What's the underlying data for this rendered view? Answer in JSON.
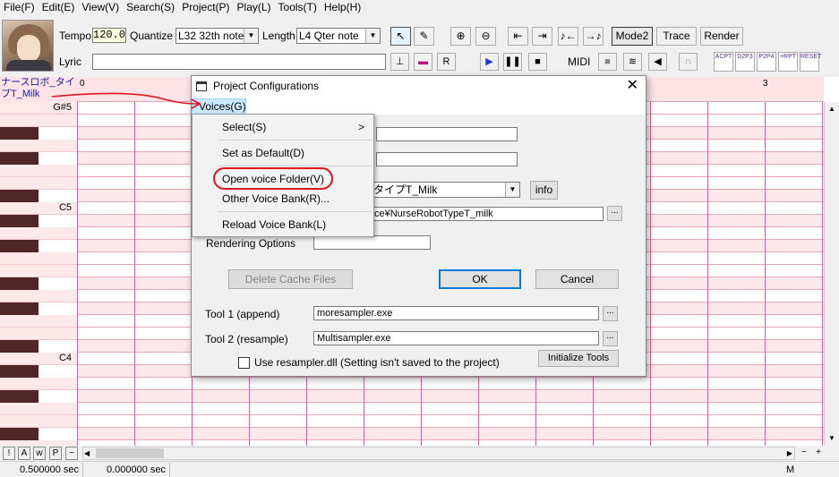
{
  "menubar": [
    "File(F)",
    "Edit(E)",
    "View(V)",
    "Search(S)",
    "Project(P)",
    "Play(L)",
    "Tools(T)",
    "Help(H)"
  ],
  "toolbar": {
    "tempo_label": "Tempo",
    "tempo_value": "120.0",
    "quantize_label": "Quantize",
    "quantize_value": "L32 32th note",
    "length_label": "Length",
    "length_value": "L4 Qter note",
    "lyric_label": "Lyric",
    "lyric_value": "",
    "mode_label": "Mode2",
    "trace_label": "Trace",
    "render_label": "Render",
    "midi_label": "MIDI",
    "fx_buttons": [
      "ACPT",
      "D2P3",
      "P2P4",
      "+RPT",
      "RESET"
    ]
  },
  "roll": {
    "singer_line1": "ナースロボ_タイ",
    "singer_line2": "プT_Milk",
    "ruler_marks": [
      "0",
      "3"
    ],
    "key_labels": [
      "G#5",
      "C5",
      "C4"
    ]
  },
  "dialog": {
    "title": "Project Configurations",
    "menu_voices": "Voices(G)",
    "voice_combo": "タイプT_Milk",
    "info_button": "info",
    "voice_path": "ce¥NurseRobotTypeT_milk",
    "rendering_options_label": "Rendering Options",
    "rendering_options_value": "",
    "delete_cache_button": "Delete Cache Files",
    "ok_button": "OK",
    "cancel_button": "Cancel",
    "tool1_label": "Tool 1 (append)",
    "tool1_value": "moresampler.exe",
    "tool2_label": "Tool 2 (resample)",
    "tool2_value": "Multisampler.exe",
    "use_resampler_label": "Use resampler.dll (Setting isn't saved to the project)",
    "initialize_tools_button": "Initialize Tools",
    "browse_label": "..."
  },
  "voice_menu": {
    "items": [
      "Select(S)",
      "Set as Default(D)",
      "Open voice Folder(V)",
      "Other Voice Bank(R)...",
      "Reload Voice Bank(L)"
    ],
    "submenu_arrow": ">"
  },
  "bottom": {
    "mini_buttons": [
      "!",
      "A",
      "w",
      "P",
      "~"
    ],
    "status_left": "0.500000 sec",
    "status_mid": "0.000000 sec",
    "status_right": "M"
  },
  "colors": {
    "annotation_red": "#e0161e",
    "roll_pink": "#fde8ec",
    "bar_line": "#cc66a0"
  }
}
